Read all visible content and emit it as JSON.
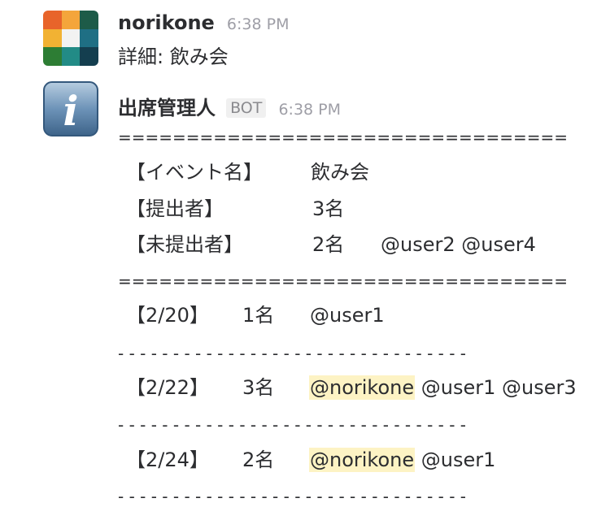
{
  "messages": {
    "user": {
      "username": "norikone",
      "time": "6:38 PM",
      "text": "詳細: 飲み会"
    },
    "bot": {
      "username": "出席管理人",
      "badge": "BOT",
      "time": "6:38 PM",
      "separator_double": "=================================",
      "separator_dash": "- - - - - - - - - - - - - - - - - - - - - - - - - - - - - - - -",
      "summary": [
        {
          "label": "【イベント名】",
          "value": "飲み会",
          "mentions": []
        },
        {
          "label": "【提出者】",
          "value": "3名",
          "mentions": []
        },
        {
          "label": "【未提出者】",
          "value": "2名",
          "mentions": [
            "@user2",
            "@user4"
          ]
        }
      ],
      "dates": [
        {
          "date": "【2/20】",
          "count": "1名",
          "mentions": [
            {
              "name": "@user1",
              "self": false
            }
          ]
        },
        {
          "date": "【2/22】",
          "count": "3名",
          "mentions": [
            {
              "name": "@norikone",
              "self": true
            },
            {
              "name": "@user1",
              "self": false
            },
            {
              "name": "@user3",
              "self": false
            }
          ]
        },
        {
          "date": "【2/24】",
          "count": "2名",
          "mentions": [
            {
              "name": "@norikone",
              "self": true
            },
            {
              "name": "@user1",
              "self": false
            }
          ]
        }
      ]
    }
  },
  "colors": {
    "mention_highlight": "#fdf3c4",
    "timestamp": "#9e9ea6",
    "text": "#2c2d30"
  },
  "icons": {
    "user_avatar": "colorful-grid-avatar-icon",
    "bot_avatar": "info-icon"
  }
}
